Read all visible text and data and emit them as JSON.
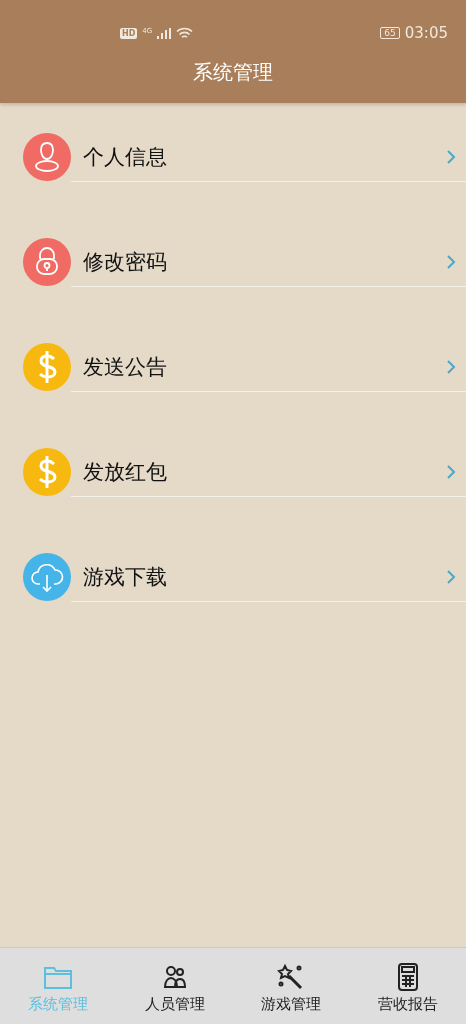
{
  "status_bar": {
    "hd": "HD",
    "network": "4G",
    "time": "03:05",
    "battery": "65"
  },
  "header": {
    "title": "系统管理"
  },
  "menu": [
    {
      "label": "个人信息",
      "kind": "person",
      "color": "#f06b63"
    },
    {
      "label": "修改密码",
      "kind": "lock",
      "color": "#f06b63"
    },
    {
      "label": "发送公告",
      "kind": "dollar",
      "color": "#f7b90f"
    },
    {
      "label": "发放红包",
      "kind": "dollar",
      "color": "#f7b90f"
    },
    {
      "label": "游戏下载",
      "kind": "cloud",
      "color": "#45b4e8"
    }
  ],
  "tabs": [
    {
      "label": "系统管理",
      "kind": "folder",
      "selected": true
    },
    {
      "label": "人员管理",
      "kind": "people",
      "selected": false
    },
    {
      "label": "游戏管理",
      "kind": "wand",
      "selected": false
    },
    {
      "label": "营收报告",
      "kind": "calculator",
      "selected": false
    }
  ]
}
